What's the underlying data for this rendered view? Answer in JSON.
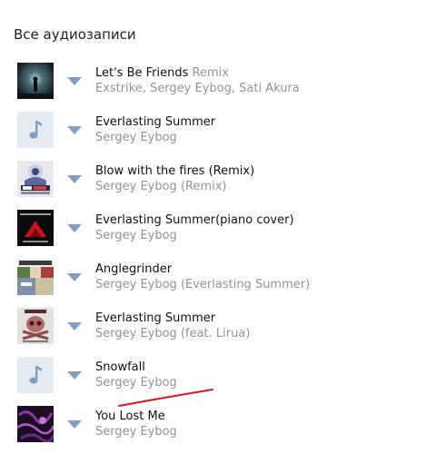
{
  "section": {
    "title": "Все аудиозаписи"
  },
  "tracks": [
    {
      "title": "Let's Be Friends",
      "subtitle": "Remix",
      "artist": "Exstrike, Sergey Eybog, Sati Akura",
      "cover": "dark-figure-cover"
    },
    {
      "title": "Everlasting Summer",
      "subtitle": "",
      "artist": "Sergey Eybog",
      "cover": "music-note-placeholder"
    },
    {
      "title": "Blow with the fires (Remix)",
      "subtitle": "",
      "artist": "Sergey Eybog (Remix)",
      "cover": "anime-cover"
    },
    {
      "title": "Everlasting Summer(piano cover)",
      "subtitle": "",
      "artist": "Sergey Eybog",
      "cover": "christmas-piano-cover"
    },
    {
      "title": "Anglegrinder",
      "subtitle": "",
      "artist": "Sergey Eybog (Everlasting Summer)",
      "cover": "collage-cover"
    },
    {
      "title": "Everlasting Summer",
      "subtitle": "",
      "artist": "Sergey Eybog (feat. Lirua)",
      "cover": "skull-cover"
    },
    {
      "title": "Snowfall",
      "subtitle": "",
      "artist": "Sergey Eybog",
      "cover": "music-note-placeholder"
    },
    {
      "title": "You Lost Me",
      "subtitle": "",
      "artist": "Sergey Eybog",
      "cover": "purple-cover"
    }
  ],
  "colors": {
    "play": "#7e9ec3",
    "artist": "#939393",
    "annotation": "#e0141e",
    "placeholder_bg": "#e5ebf1"
  }
}
